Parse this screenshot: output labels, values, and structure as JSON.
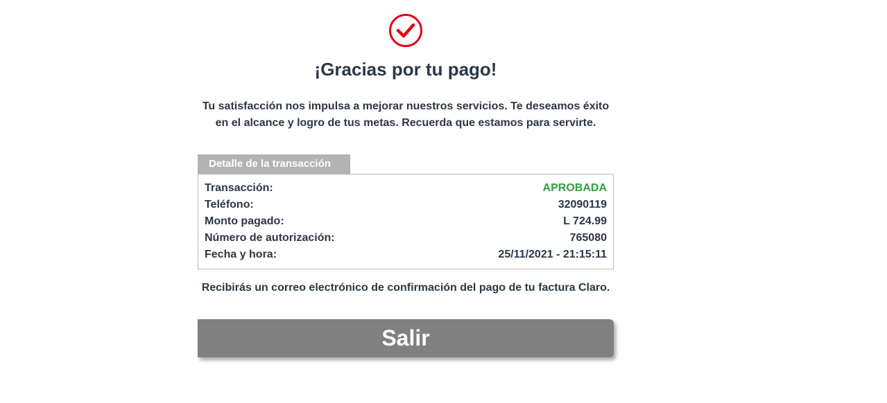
{
  "header": {
    "icon": "check-circle-icon",
    "icon_color": "#e30613",
    "title": "¡Gracias por tu pago!"
  },
  "message": {
    "line1": "Tu satisfacción nos impulsa a mejorar nuestros servicios. Te deseamos éxito",
    "line2": "en el alcance y logro de tus metas. Recuerda que estamos para servirte."
  },
  "transaction": {
    "tab_label": "Detalle de la transacción",
    "rows": [
      {
        "label": "Transacción:",
        "value": "APROBADA"
      },
      {
        "label": "Teléfono:",
        "value": "32090119"
      },
      {
        "label": "Monto pagado:",
        "value": "L 724.99"
      },
      {
        "label": "Número de autorización:",
        "value": "765080"
      },
      {
        "label": "Fecha y hora:",
        "value": "25/11/2021 - 21:15:11"
      }
    ],
    "approved_color": "#2f9f3e"
  },
  "confirmation_note": "Recibirás un correo electrónico de confirmación del pago de tu factura Claro.",
  "exit_button": {
    "label": "Salir",
    "color": "#808080"
  }
}
